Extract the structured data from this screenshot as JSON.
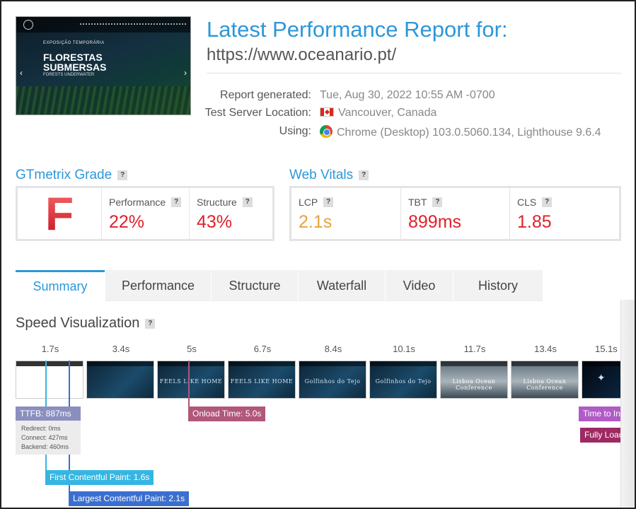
{
  "header": {
    "thumbnail": {
      "line1": "EXPOSIÇÃO TEMPORÁRIA",
      "line2a": "FLORESTAS",
      "line2b": "SUBMERSAS",
      "line3": "FORESTS UNDERWATER"
    },
    "title": "Latest Performance Report for:",
    "url": "https://www.oceanario.pt/",
    "report_generated_label": "Report generated:",
    "report_generated_value": "Tue, Aug 30, 2022 10:55 AM -0700",
    "server_label": "Test Server Location:",
    "server_value": "Vancouver, Canada",
    "using_label": "Using:",
    "using_value": "Chrome (Desktop) 103.0.5060.134, Lighthouse 9.6.4"
  },
  "grade": {
    "title": "GTmetrix Grade",
    "help": "?",
    "letter": "F",
    "performance_label": "Performance",
    "performance_value": "22%",
    "structure_label": "Structure",
    "structure_value": "43%",
    "colors": {
      "bad": "#e0202a"
    }
  },
  "vitals": {
    "title": "Web Vitals",
    "help": "?",
    "lcp_label": "LCP",
    "lcp_value": "2.1s",
    "tbt_label": "TBT",
    "tbt_value": "899ms",
    "cls_label": "CLS",
    "cls_value": "1.85",
    "colors": {
      "warn": "#e8a33a",
      "bad": "#e0202a"
    }
  },
  "tabs": [
    {
      "label": "Summary",
      "active": true
    },
    {
      "label": "Performance",
      "active": false
    },
    {
      "label": "Structure",
      "active": false
    },
    {
      "label": "Waterfall",
      "active": false
    },
    {
      "label": "Video",
      "active": false
    },
    {
      "label": "History",
      "active": false
    }
  ],
  "speed": {
    "title": "Speed Visualization",
    "help": "?",
    "ticks": [
      "1.7s",
      "3.4s",
      "5s",
      "6.7s",
      "8.4s",
      "10.1s",
      "11.7s",
      "13.4s",
      "15.1s"
    ],
    "frame_texts": [
      "",
      "",
      "FEELS LIKE HOME",
      "FEELS LIKE HOME",
      "Golfinhos do Tejo",
      "Golfinhos do Tejo",
      "Lisboa Ocean Conference",
      "Lisboa Ocean Conference",
      ""
    ],
    "ttfb_label": "TTFB: 887ms",
    "redirect": "Redirect: 0ms",
    "connect": "Connect: 427ms",
    "backend": "Backend: 460ms",
    "onload_label": "Onload Time: 5.0s",
    "tti_label": "Time to Interactive",
    "fully_loaded_label": "Fully Loaded",
    "fcp_label": "First Contentful Paint: 1.6s",
    "lcp_label": "Largest Contentful Paint: 2.1s",
    "colors": {
      "ttfb": "#8a8fbf",
      "onload": "#b0577a",
      "tti": "#b15bc6",
      "fully": "#9d2a63",
      "fcp": "#35b6e2",
      "lcp": "#3a6fd0"
    }
  }
}
